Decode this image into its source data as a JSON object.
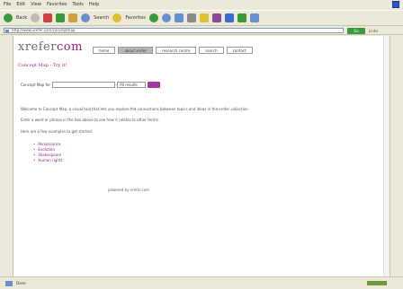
{
  "menu": [
    "File",
    "Edit",
    "View",
    "Favorites",
    "Tools",
    "Help"
  ],
  "toolbar": {
    "back": "Back",
    "search": "Search",
    "favorites": "Favorites"
  },
  "address": {
    "url": "http://www.xrefer.com/conceptmap",
    "go": "Go",
    "links": "Links"
  },
  "site": {
    "logo_a": "xrefer",
    "logo_b": "com"
  },
  "nav": [
    "home",
    "about xrefer",
    "research centre",
    "search",
    "contact"
  ],
  "page": {
    "title": "Concept Map - Try it!"
  },
  "search": {
    "label": "Concept Map for",
    "select": "All results"
  },
  "para1": "Welcome to Concept Map, a visual tool that lets you explore the connections between topics and ideas in the xrefer collection.",
  "para2": "Enter a word or phrase in the box above to see how it relates to other terms.",
  "para3": "Here are a few examples to get started:",
  "examples": [
    "Renaissance",
    "Evolution",
    "Shakespeare",
    "Human rights"
  ],
  "footer": "powered by xrefer.com",
  "status": "Done",
  "colors": {
    "accent": "#9b1f7f",
    "xp_blue": "#2a55c8"
  }
}
